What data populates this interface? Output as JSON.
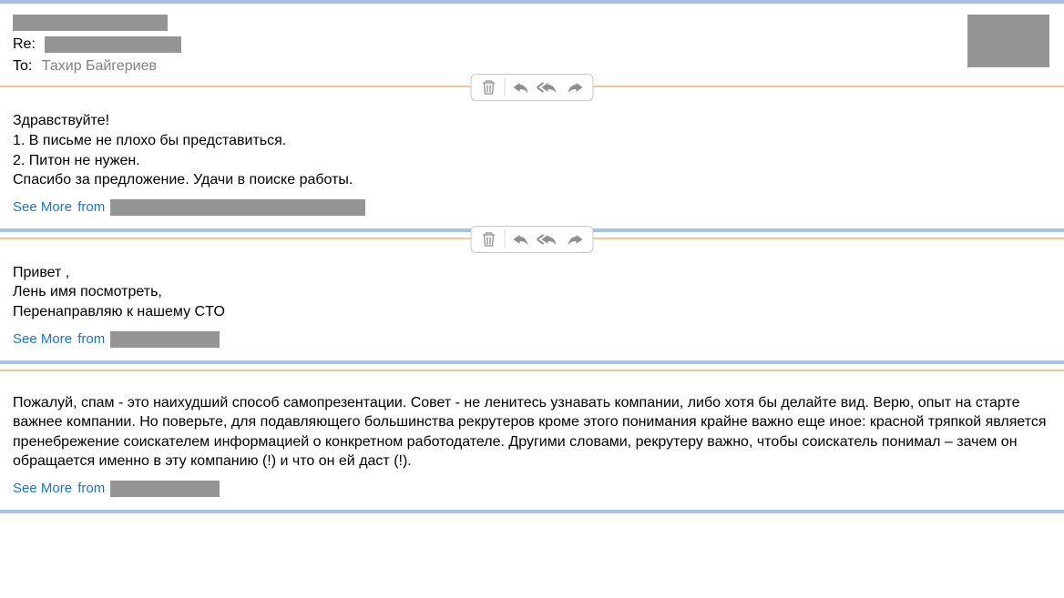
{
  "colors": {
    "separator": "#a6c2e8",
    "subline": "#f1c39a",
    "redact": "#949494",
    "link": "#1a74d4"
  },
  "header": {
    "re_label": "Re:",
    "to_label": "To:",
    "to_name": "Тахир Байгериев"
  },
  "emails": [
    {
      "lines": [
        "Здравствуйте!",
        "1. В письме не плохо бы представиться.",
        "2. Питон не нужен.",
        "Спасибо за предложение. Удачи в поиске работы."
      ],
      "see_more": "See More",
      "from": "from"
    },
    {
      "lines": [
        "Привет ,",
        "Лень имя посмотреть,",
        "Перенаправляю к нашему CTO"
      ],
      "see_more": "See More",
      "from": "from"
    },
    {
      "lines": [
        "Пожалуй, спам - это наихудший способ самопрезентации. Совет - не ленитесь узнавать компании, либо хотя бы делайте вид. Верю, опыт на старте важнее компании. Но поверьте, для подавляющего большинства рекрутеров кроме этого понимания крайне важно еще иное: красной тряпкой является пренебрежение соискателем информацией о конкретном работодателе. Другими словами, рекрутеру важно, чтобы соискатель понимал – зачем он обращается именно в эту компанию (!) и что он ей даст (!)."
      ],
      "see_more": "See More",
      "from": "from"
    }
  ]
}
